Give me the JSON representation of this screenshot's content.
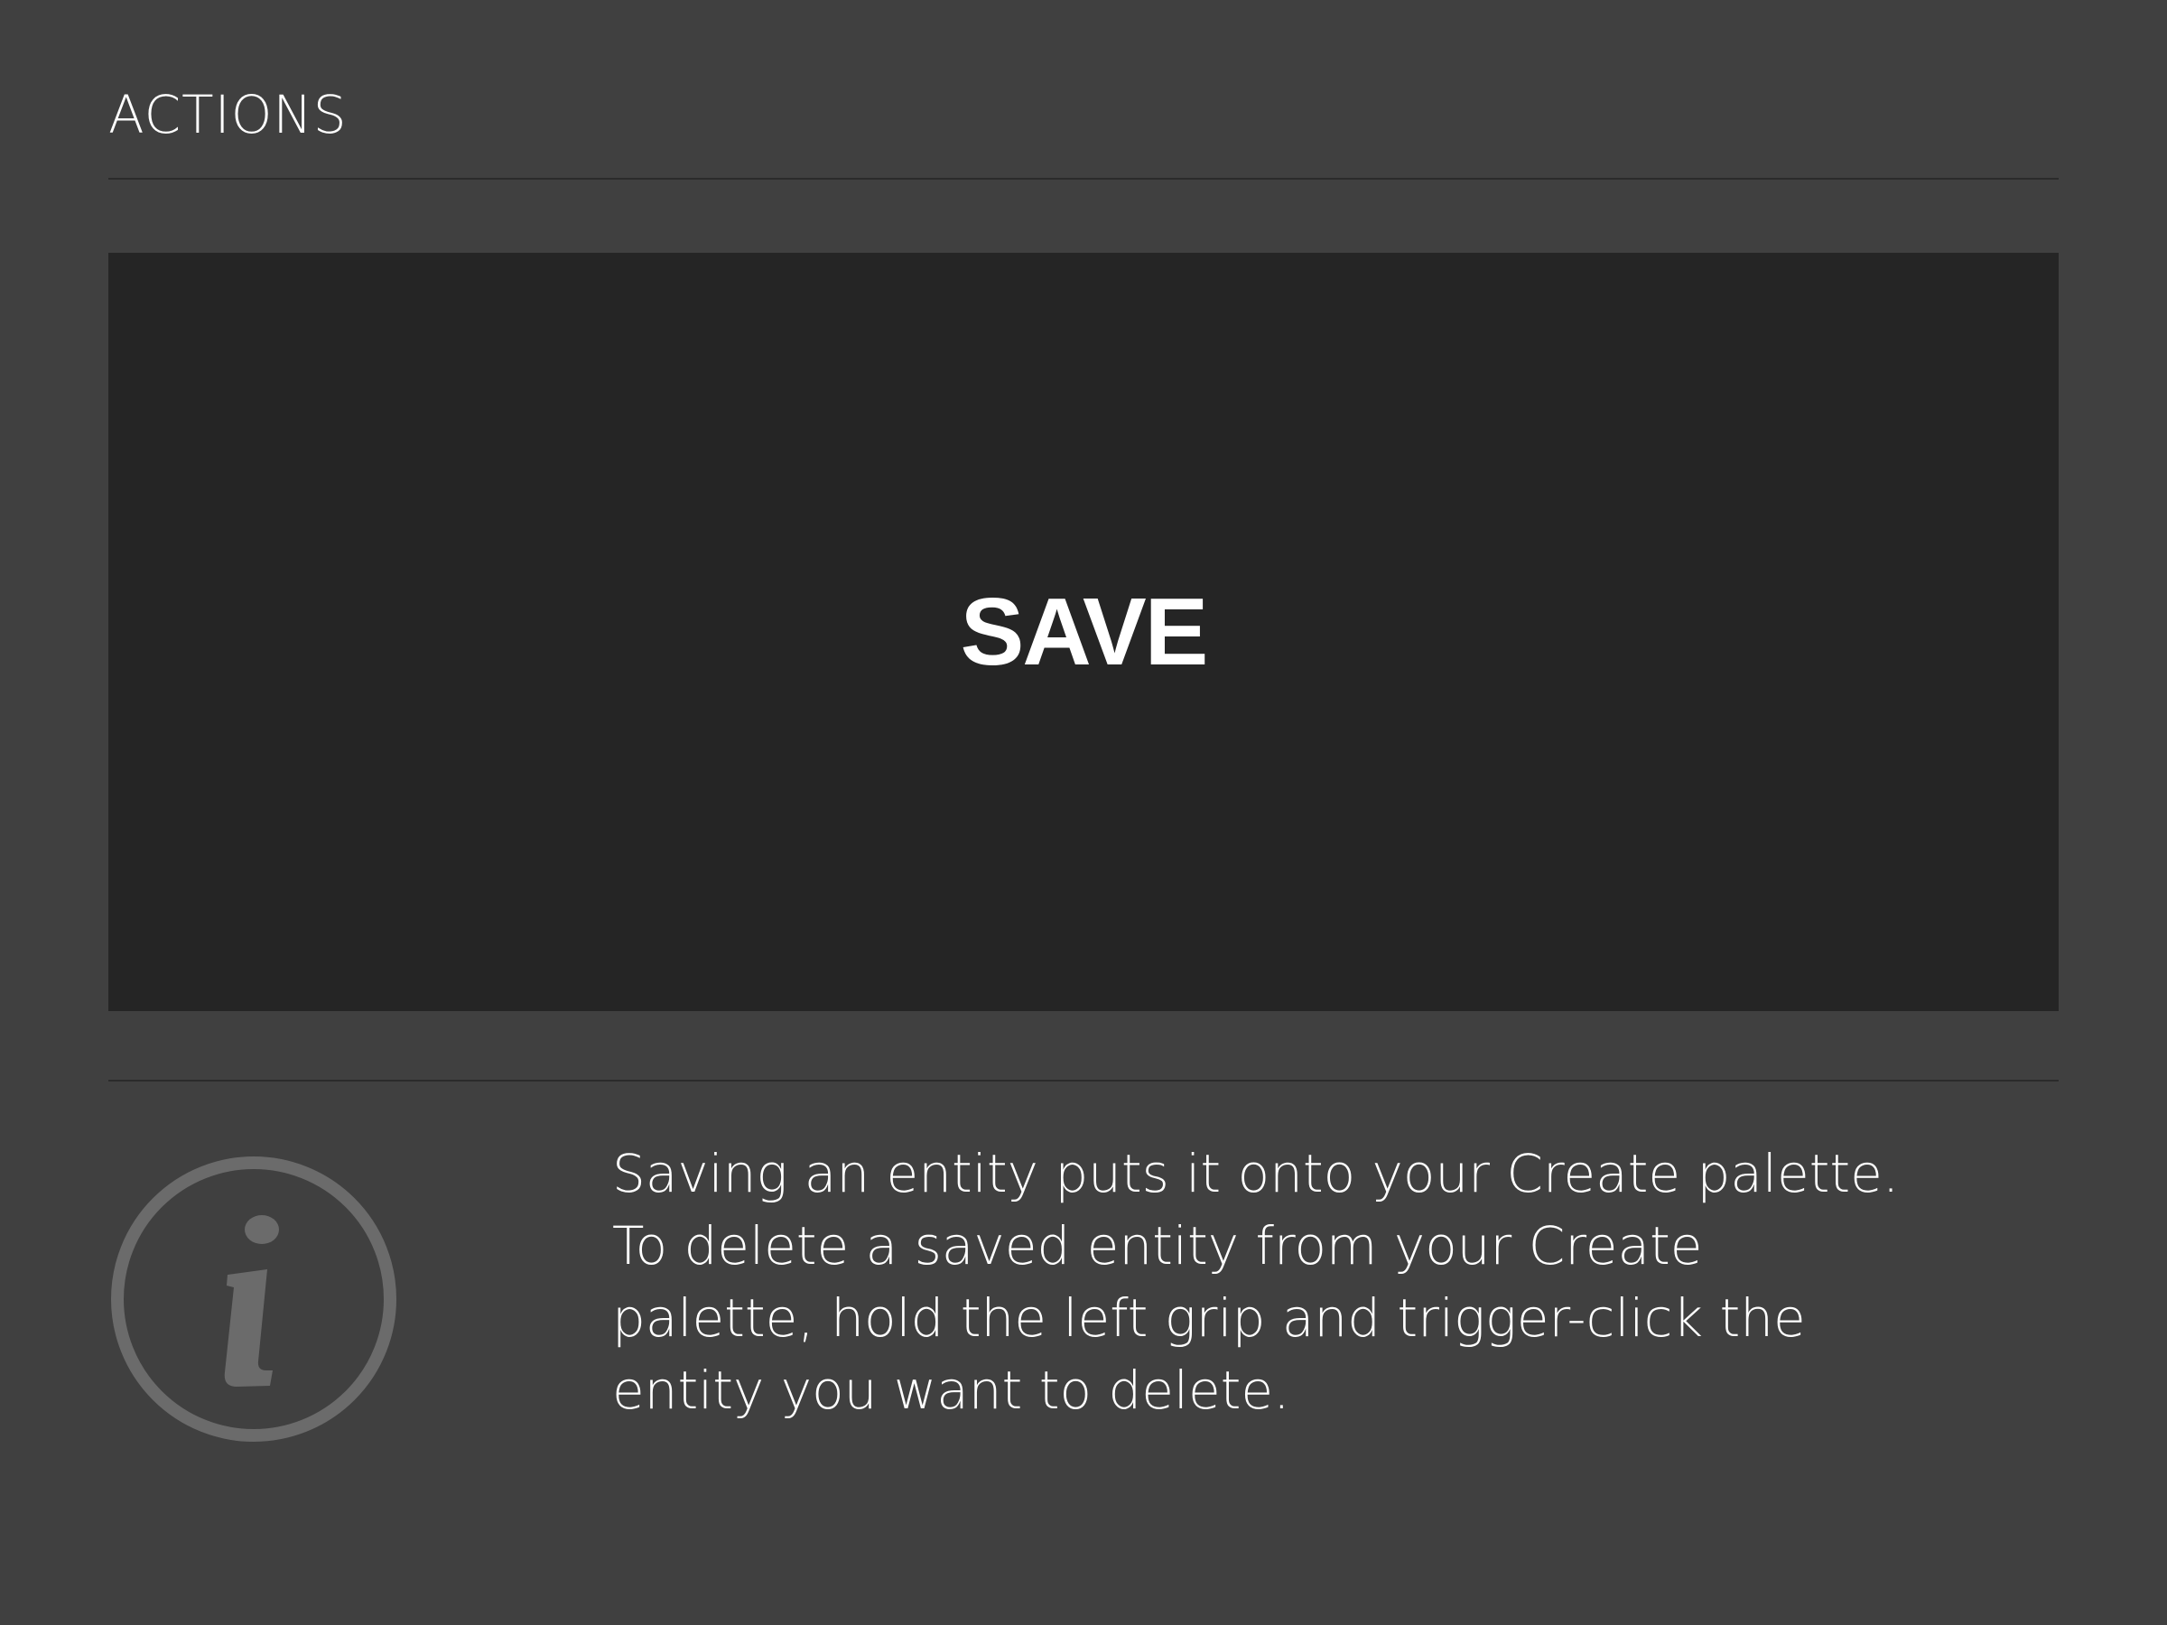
{
  "panel": {
    "section_title": "ACTIONS"
  },
  "save_button": {
    "label": "SAVE"
  },
  "info": {
    "icon": "info-icon",
    "lines": [
      "Saving an entity puts it onto your Create palette.",
      "To delete a saved entity from your Create",
      "palette, hold the left grip and trigger-click the",
      "entity you want to delete."
    ]
  },
  "colors": {
    "background": "#404040",
    "button": "#252525",
    "divider": "#2b2b2b",
    "icon": "#6b6b6b",
    "text": "#ffffff"
  }
}
